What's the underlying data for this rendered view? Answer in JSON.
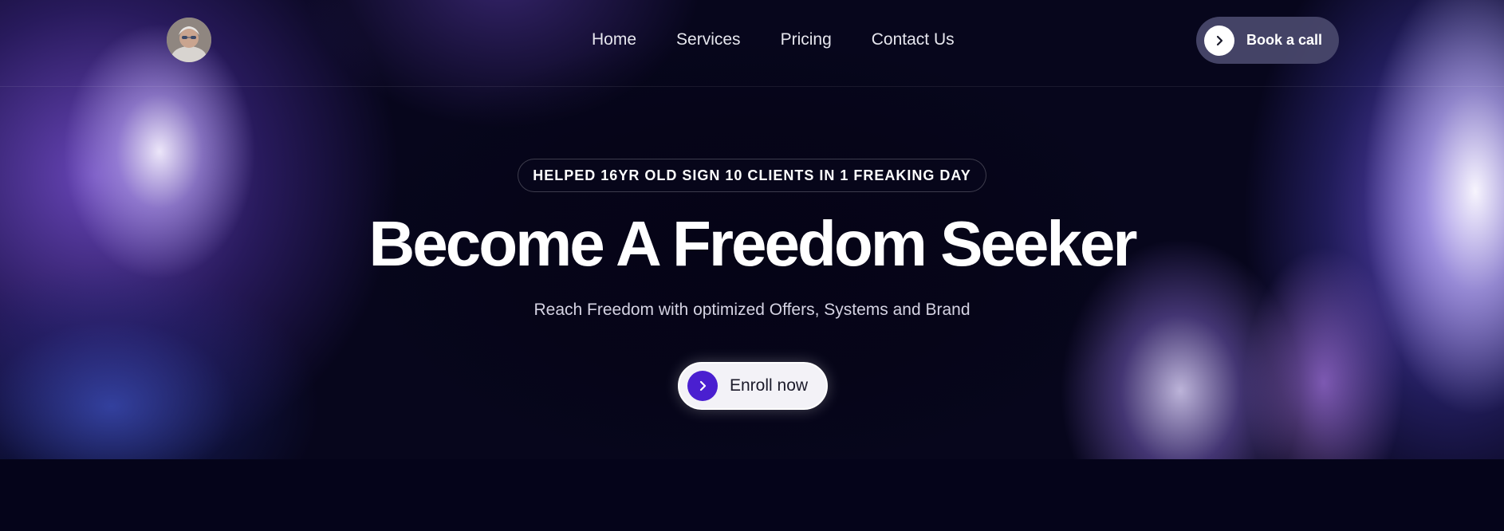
{
  "nav": {
    "links": [
      "Home",
      "Services",
      "Pricing",
      "Contact Us"
    ],
    "cta_label": "Book a call"
  },
  "hero": {
    "badge": "HELPED 16YR OLD SIGN 10 CLIENTS IN 1 FREAKING DAY",
    "headline": "Become A Freedom Seeker",
    "subheadline": "Reach Freedom with optimized Offers, Systems and Brand",
    "cta_label": "Enroll now"
  },
  "icons": {
    "top_cta": "chevron-right-icon",
    "enroll_cta": "chevron-right-icon"
  },
  "colors": {
    "background": "#05041a",
    "accent": "#4a1fd0",
    "nav_cta_bg": "#4a496c",
    "enroll_bg": "#f3f2f7"
  }
}
